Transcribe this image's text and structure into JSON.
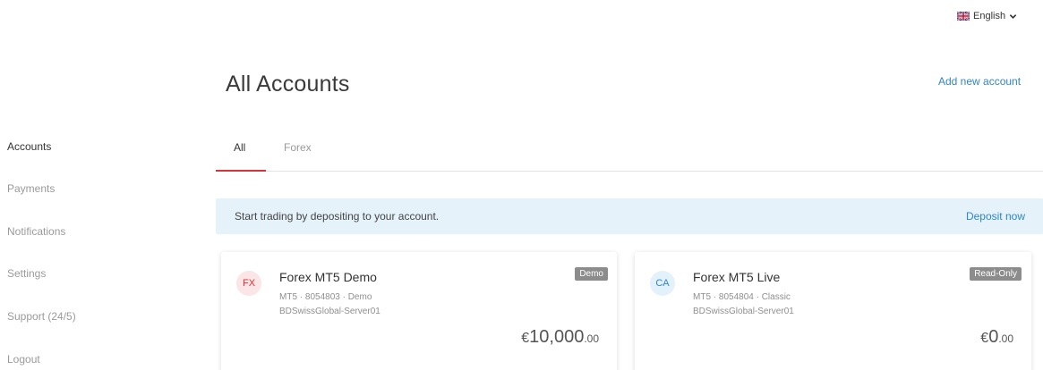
{
  "language": {
    "label": "English",
    "flag_icon": "uk-flag-icon",
    "chevron_icon": "chevron-down-icon"
  },
  "sidebar": {
    "items": [
      {
        "label": "Accounts",
        "active": true
      },
      {
        "label": "Payments",
        "active": false
      },
      {
        "label": "Notifications",
        "active": false
      },
      {
        "label": "Settings",
        "active": false
      },
      {
        "label": "Support (24/5)",
        "active": false
      },
      {
        "label": "Logout",
        "active": false
      }
    ]
  },
  "header": {
    "title": "All Accounts",
    "add_account_label": "Add new account"
  },
  "tabs": [
    {
      "label": "All",
      "active": true
    },
    {
      "label": "Forex",
      "active": false
    }
  ],
  "banner": {
    "text": "Start trading by depositing to your account.",
    "action_label": "Deposit now"
  },
  "accounts": [
    {
      "avatar": "FX",
      "name": "Forex MT5 Demo",
      "details": "MT5 · 8054803 · Demo",
      "server": "BDSwissGlobal-Server01",
      "badge": "Demo",
      "currency": "€",
      "balance_int": "10,000",
      "balance_dec": ".00"
    },
    {
      "avatar": "CA",
      "name": "Forex MT5 Live",
      "details": "MT5 · 8054804 · Classic",
      "server": "BDSwissGlobal-Server01",
      "badge": "Read-Only",
      "currency": "€",
      "balance_int": "0",
      "balance_dec": ".00"
    }
  ],
  "colors": {
    "accent_red": "#d9343b",
    "link_blue": "#2f86c9",
    "banner_bg": "#e5f2fa",
    "badge_gray": "#8c8c8c"
  }
}
